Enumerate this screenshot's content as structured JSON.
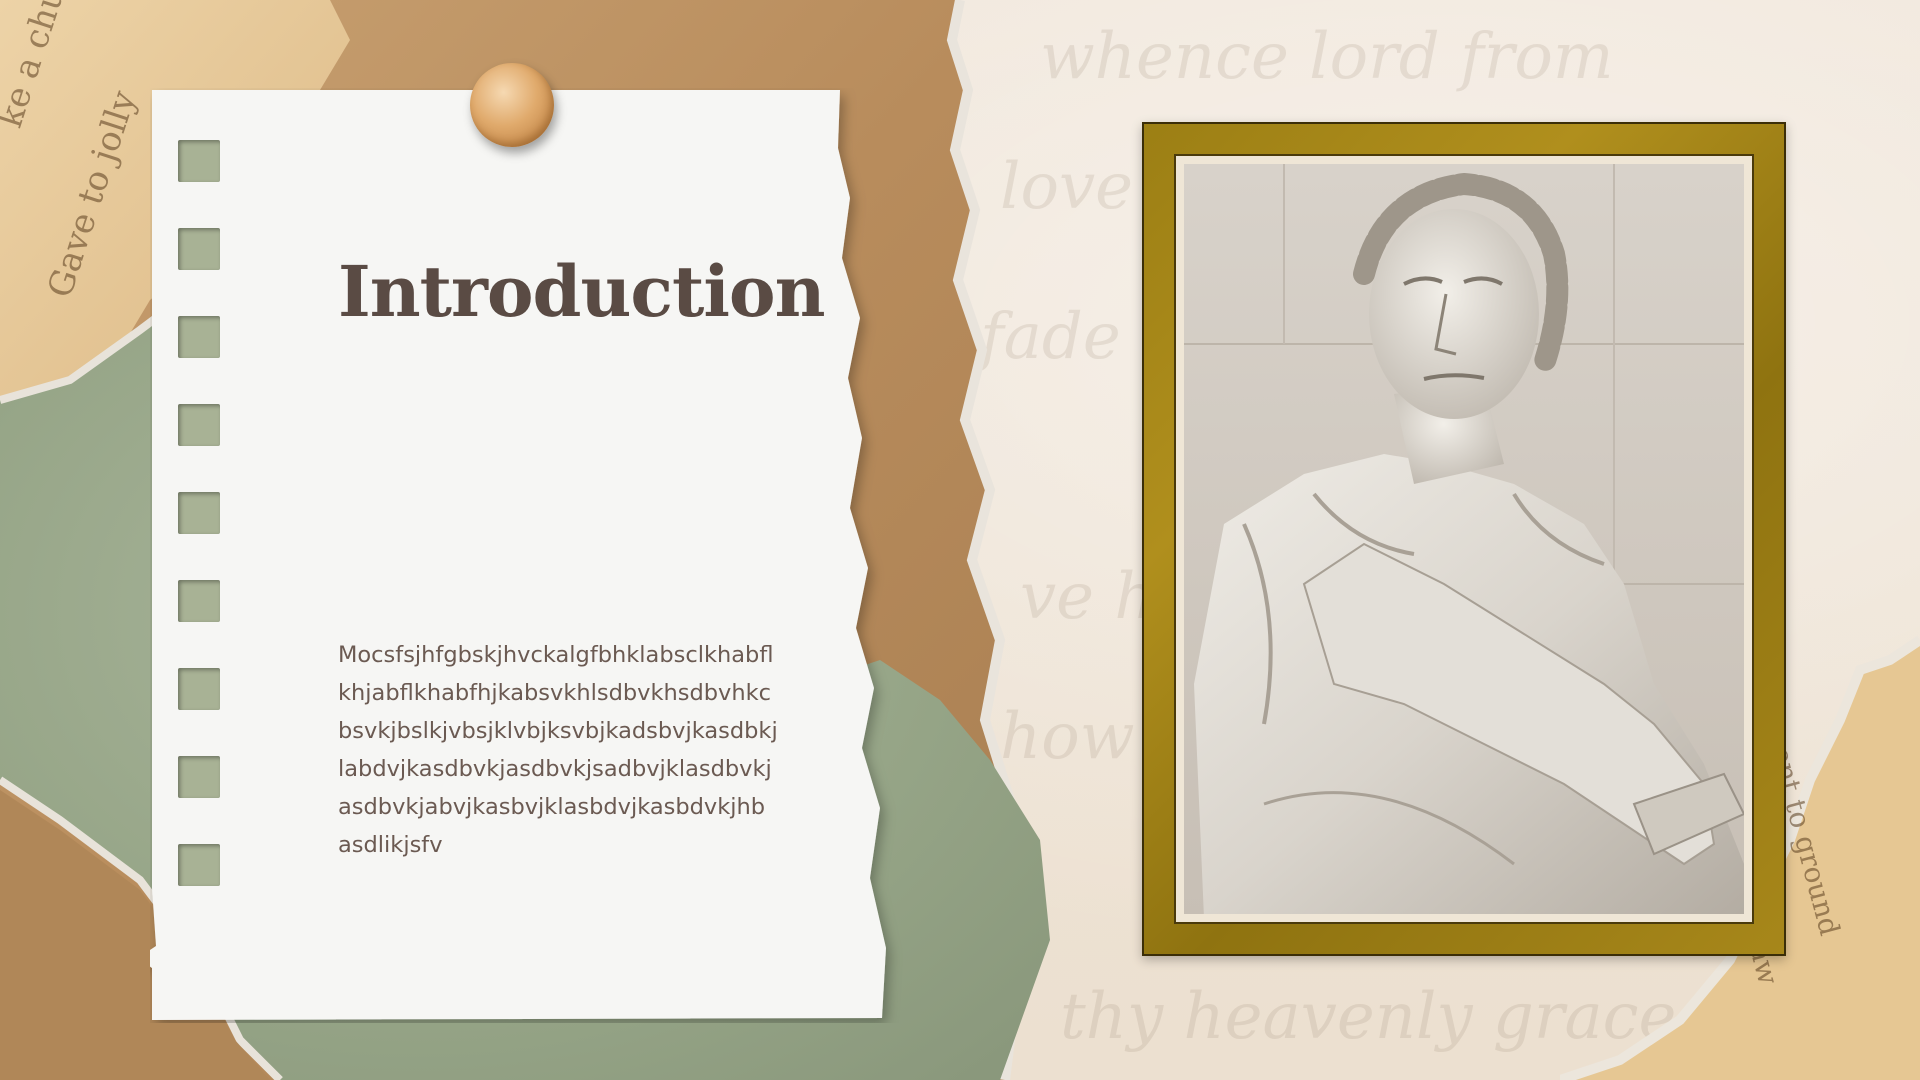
{
  "slide": {
    "title": "Introduction",
    "body": "Mocsfsjhfgbskjhvckalgfbhklabsclkhabflkhjabflkhabfhjkabsvkhlsdbvkhsdbvhkcbsvkjbslkjvbsjklvbjksvbjkadsbvjkasdbkjlabdvjkasdbvkjasdbvkjsadbvjklasdbvkjasdbvkjabvjkasbvjklasbdvjkasbdvkjhbasdlikjsfv"
  },
  "image": {
    "subject": "marble statue of a laurel-crowned Roman figure",
    "frame": "gold-frame-icon"
  },
  "decor": {
    "pin": "pushpin-icon",
    "colors": {
      "title": "#5a4b44",
      "body": "#6b5a52",
      "frame": "#9c7f14",
      "sage": "#9aa98b",
      "kraft": "#b88d5e"
    }
  }
}
